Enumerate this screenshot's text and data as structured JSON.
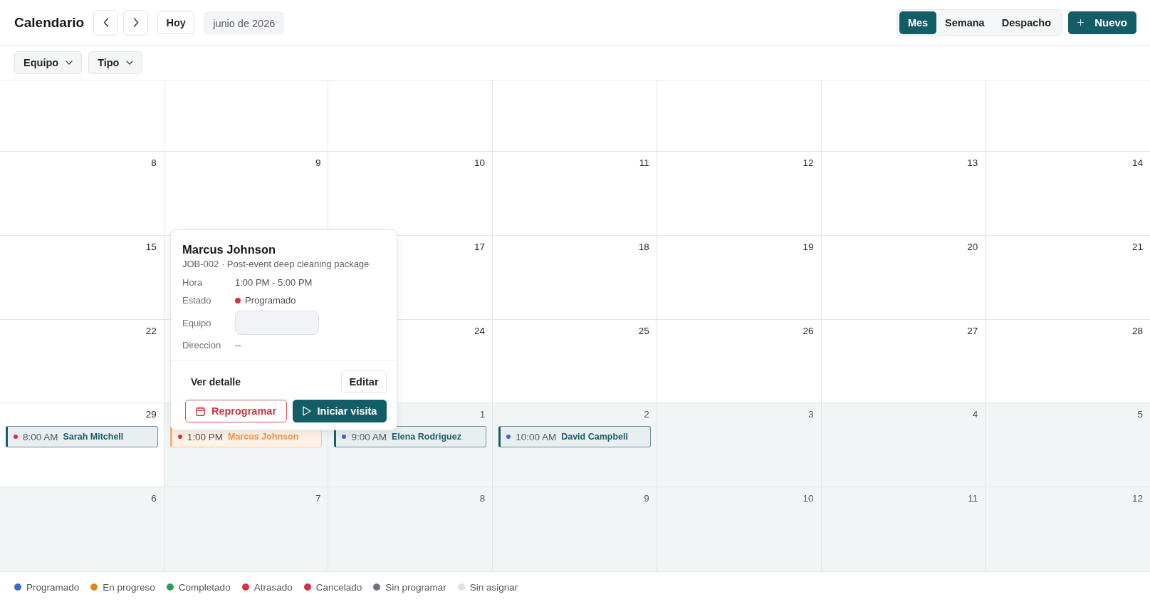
{
  "header": {
    "title": "Calendario",
    "today_button": "Hoy",
    "period": "junio de 2026",
    "views": [
      {
        "label": "Mes",
        "selected": true
      },
      {
        "label": "Semana",
        "selected": false
      },
      {
        "label": "Despacho",
        "selected": false
      }
    ],
    "new_button": "Nuevo"
  },
  "filters": [
    {
      "label": "Equipo"
    },
    {
      "label": "Tipo"
    }
  ],
  "calendar": {
    "weeks": [
      {
        "days": [
          {
            "shaded": false
          },
          {
            "shaded": false
          },
          {
            "shaded": false
          },
          {
            "shaded": false
          },
          {
            "shaded": false
          },
          {
            "shaded": false
          },
          {
            "shaded": false
          }
        ]
      },
      {
        "days": [
          {
            "day": "8",
            "shaded": false
          },
          {
            "day": "9",
            "shaded": false
          },
          {
            "day": "10",
            "shaded": false
          },
          {
            "day": "11",
            "shaded": false
          },
          {
            "day": "12",
            "shaded": false
          },
          {
            "day": "13",
            "shaded": false
          },
          {
            "day": "14",
            "shaded": false
          }
        ]
      },
      {
        "days": [
          {
            "day": "15",
            "shaded": false
          },
          {
            "shaded": false
          },
          {
            "day": "17",
            "shaded": false
          },
          {
            "day": "18",
            "shaded": false
          },
          {
            "day": "19",
            "shaded": false
          },
          {
            "day": "20",
            "shaded": false
          },
          {
            "day": "21",
            "shaded": false
          }
        ]
      },
      {
        "days": [
          {
            "day": "22",
            "shaded": false
          },
          {
            "shaded": false
          },
          {
            "day": "24",
            "shaded": false
          },
          {
            "day": "25",
            "shaded": false
          },
          {
            "day": "26",
            "shaded": false
          },
          {
            "day": "27",
            "shaded": false
          },
          {
            "day": "28",
            "shaded": false
          }
        ]
      },
      {
        "days": [
          {
            "day": "29",
            "shaded": false,
            "events": [
              {
                "time": "8:00 AM",
                "name": "Sarah Mitchell",
                "color": "#d63341",
                "selected": false
              }
            ]
          },
          {
            "shaded": true,
            "events": [
              {
                "time": "1:00 PM",
                "name": "Marcus Johnson",
                "color": "#d63341",
                "selected": true
              }
            ]
          },
          {
            "day": "1",
            "shaded": true,
            "events": [
              {
                "time": "9:00 AM",
                "name": "Elena Rodriguez",
                "color": "#3a6cc6",
                "selected": false
              }
            ]
          },
          {
            "day": "2",
            "shaded": true,
            "events": [
              {
                "time": "10:00 AM",
                "name": "David Campbell",
                "color": "#3a6cc6",
                "selected": false
              }
            ]
          },
          {
            "day": "3",
            "shaded": true
          },
          {
            "day": "4",
            "shaded": true
          },
          {
            "day": "5",
            "shaded": true
          }
        ]
      },
      {
        "days": [
          {
            "day": "6",
            "shaded": true
          },
          {
            "day": "7",
            "shaded": true
          },
          {
            "day": "8",
            "shaded": true
          },
          {
            "day": "9",
            "shaded": true
          },
          {
            "day": "10",
            "shaded": true
          },
          {
            "day": "11",
            "shaded": true
          },
          {
            "day": "12",
            "shaded": true
          }
        ]
      }
    ]
  },
  "popover": {
    "title": "Marcus Johnson",
    "subtitle": "JOB-002 · Post-event deep cleaning package",
    "fields": [
      {
        "kind": "text",
        "label": "Hora",
        "value": "1:00 PM - 5:00 PM"
      },
      {
        "kind": "status",
        "label": "Estado",
        "value": "Programado",
        "color": "#d63341"
      },
      {
        "kind": "field",
        "label": "Equipo"
      },
      {
        "kind": "text",
        "label": "Direccion",
        "value": "--"
      }
    ],
    "action_rows": [
      {
        "buttons": [
          {
            "kind": "ghost",
            "label": "Ver detalle"
          },
          {
            "kind": "outline",
            "label": "Editar"
          }
        ]
      },
      {
        "buttons": [
          {
            "kind": "danger",
            "label": "Reprogramar"
          },
          {
            "kind": "primary",
            "label": "Iniciar visita"
          }
        ]
      }
    ]
  },
  "legend": [
    {
      "label": "Programado",
      "color": "#3a6cc6"
    },
    {
      "label": "En progreso",
      "color": "#d9861c"
    },
    {
      "label": "Completado",
      "color": "#2f9e52"
    },
    {
      "label": "Atrasado",
      "color": "#d63341"
    },
    {
      "label": "Cancelado",
      "color": "#d63341"
    },
    {
      "label": "Sin programar",
      "color": "#6b747c"
    },
    {
      "label": "Sin asignar",
      "color": "#dfe2e5"
    }
  ]
}
